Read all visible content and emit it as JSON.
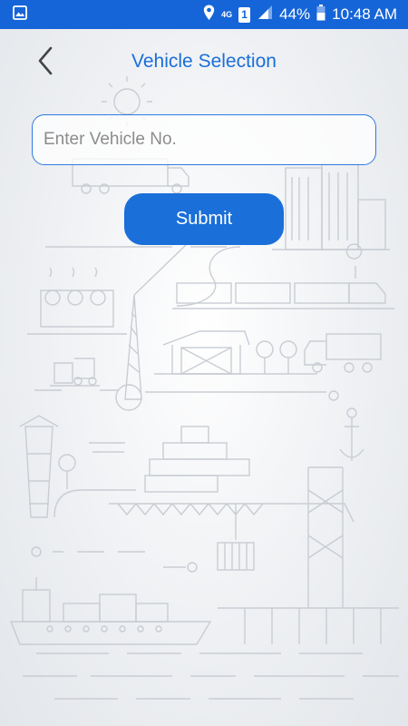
{
  "status_bar": {
    "network": "4G",
    "sim": "1",
    "battery_percent": "44%",
    "time": "10:48 AM",
    "icons": [
      "image-icon",
      "location-icon",
      "signal-icon",
      "battery-icon"
    ]
  },
  "header": {
    "title": "Vehicle Selection",
    "back_icon": "chevron-left-icon"
  },
  "form": {
    "vehicle_input": {
      "placeholder": "Enter Vehicle No.",
      "value": ""
    },
    "submit_label": "Submit"
  },
  "colors": {
    "status_bar": "#1565d8",
    "accent": "#1a6fd9",
    "background": "#eef0f3",
    "line_art": "#c9cdd3"
  }
}
